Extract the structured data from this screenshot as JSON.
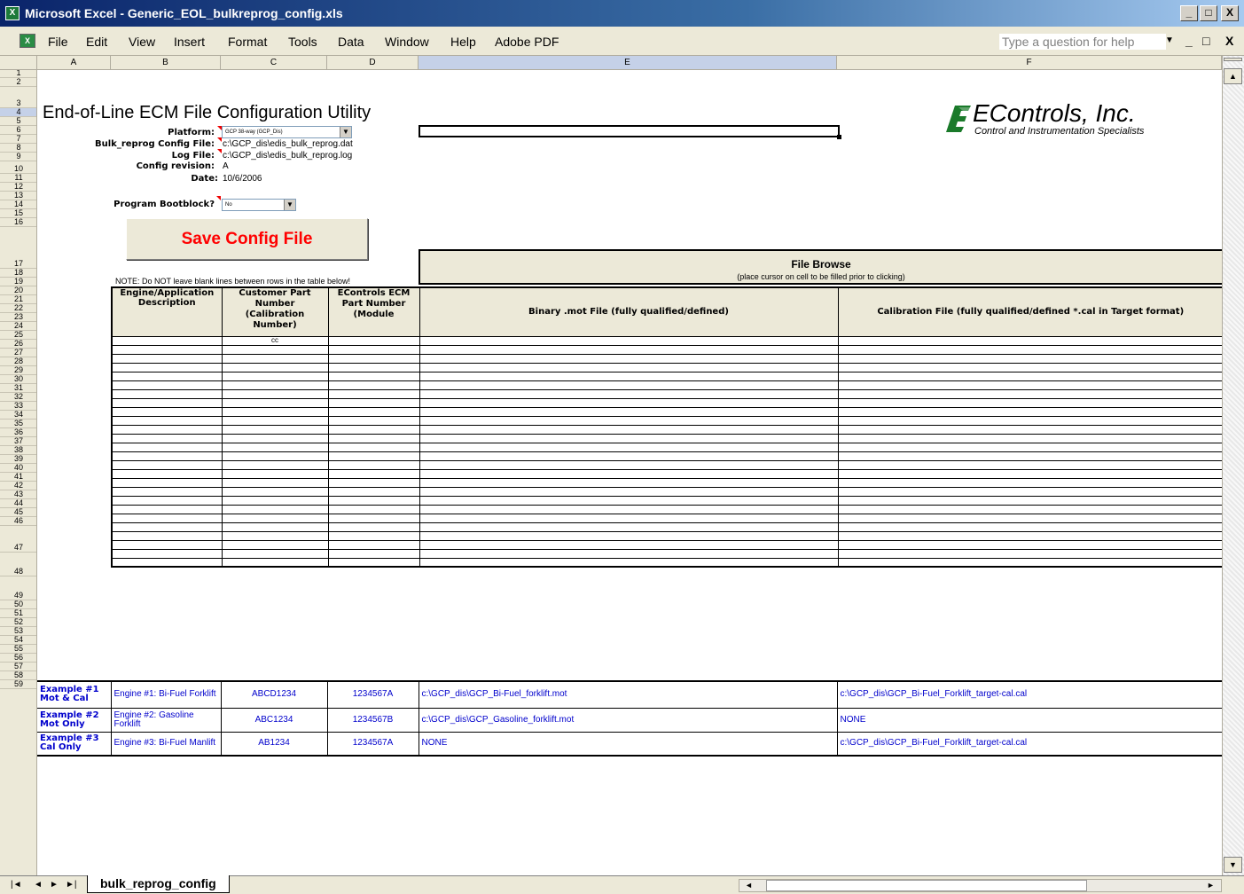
{
  "window": {
    "title": "Microsoft Excel - Generic_EOL_bulkreprog_config.xls",
    "minimize": "_",
    "maximize": "□",
    "close": "X"
  },
  "menu": {
    "items": [
      "File",
      "Edit",
      "View",
      "Insert",
      "Format",
      "Tools",
      "Data",
      "Window",
      "Help",
      "Adobe PDF"
    ],
    "help_placeholder": "Type a question for help",
    "help_arrow": "▼",
    "mdi_min": "_",
    "mdi_restore": "□",
    "mdi_close": "X"
  },
  "columns": [
    "A",
    "B",
    "C",
    "D",
    "E",
    "F"
  ],
  "selected_column": "E",
  "selected_row": "4",
  "rows": [
    "1",
    "2",
    "3",
    "4",
    "5",
    "6",
    "7",
    "8",
    "9",
    "10",
    "11",
    "12",
    "13",
    "14",
    "15",
    "16",
    "17",
    "18",
    "19",
    "20",
    "21",
    "22",
    "23",
    "24",
    "25",
    "26",
    "27",
    "28",
    "29",
    "30",
    "31",
    "32",
    "33",
    "34",
    "35",
    "36",
    "37",
    "38",
    "39",
    "40",
    "41",
    "42",
    "43",
    "44",
    "45",
    "46",
    "47",
    "48",
    "49",
    "50",
    "51",
    "52",
    "53",
    "54",
    "55",
    "56",
    "57",
    "58",
    "59"
  ],
  "header": {
    "title": "End-of-Line ECM File Configuration Utility",
    "platform_label": "Platform:",
    "platform_value": "GCP 38-way (GCP_Dis)",
    "bulk_label": "Bulk_reprog Config File:",
    "bulk_value": "c:\\GCP_dis\\edis_bulk_reprog.dat",
    "log_label": "Log File:",
    "log_value": "c:\\GCP_dis\\edis_bulk_reprog.log",
    "rev_label": "Config revision:",
    "rev_value": "A",
    "date_label": "Date:",
    "date_value": "10/6/2006",
    "bootblock_label": "Program Bootblock?",
    "bootblock_value": "No"
  },
  "save_button": "Save Config File",
  "note": "NOTE:  Do NOT leave blank lines between rows in the table below!",
  "file_browse": {
    "title": "File Browse",
    "subtitle": "(place cursor on cell to be filled prior to clicking)"
  },
  "table_headers": {
    "engine": "Engine/Application Description",
    "customer": "Customer Part Number (Calibration Number)",
    "econtrols": "EControls ECM Part Number (Module",
    "binary": "Binary .mot File (fully qualified/defined)",
    "calibration": "Calibration File (fully qualified/defined *.cal in Target format)"
  },
  "first_row_customer": "cc",
  "examples": [
    {
      "label": "Example #1 Mot & Cal",
      "engine": "Engine #1: Bi-Fuel Forklift",
      "customer": "ABCD1234",
      "ecm": "1234567A",
      "mot": "c:\\GCP_dis\\GCP_Bi-Fuel_forklift.mot",
      "cal": "c:\\GCP_dis\\GCP_Bi-Fuel_Forklift_target-cal.cal"
    },
    {
      "label": "Example #2 Mot Only",
      "engine": "Engine #2: Gasoline Forklift",
      "customer": "ABC1234",
      "ecm": "1234567B",
      "mot": "c:\\GCP_dis\\GCP_Gasoline_forklift.mot",
      "cal": "NONE"
    },
    {
      "label": "Example #3 Cal Only",
      "engine": "Engine #3: Bi-Fuel Manlift",
      "customer": "AB1234",
      "ecm": "1234567A",
      "mot": "NONE",
      "cal": "c:\\GCP_dis\\GCP_Bi-Fuel_Forklift_target-cal.cal"
    }
  ],
  "logo": {
    "name": "EControls, Inc.",
    "tagline": "Control and Instrumentation Specialists"
  },
  "sheet_tab": "bulk_reprog_config",
  "nav": [
    "|◄",
    "◄",
    "►",
    "►|"
  ],
  "scroll_up": "▲",
  "scroll_down": "▼",
  "scroll_left": "◄",
  "scroll_right": "►",
  "colors": {
    "title_from": "#0a246a",
    "title_to": "#a6caf0",
    "chrome": "#ece9d8",
    "accent_red": "#ff0000",
    "example_blue": "#0000cc"
  }
}
